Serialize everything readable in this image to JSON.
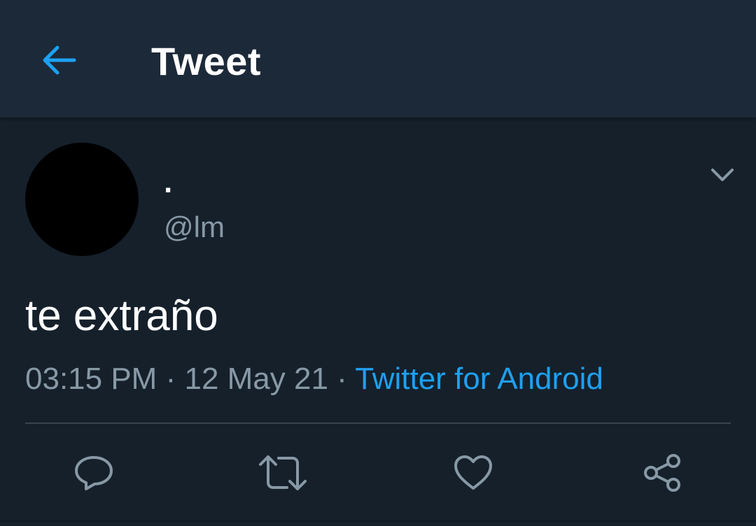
{
  "header": {
    "title": "Tweet",
    "back_icon": "arrow-left-icon"
  },
  "tweet": {
    "display_name": ".",
    "handle": "@lm",
    "text": "te extraño",
    "time": "03:15 PM",
    "date": "12 May 21",
    "separator": "·",
    "source": "Twitter for Android",
    "menu_icon": "chevron-down-icon"
  },
  "actions": [
    "reply-icon",
    "retweet-icon",
    "like-icon",
    "share-icon"
  ],
  "colors": {
    "background": "#15202b",
    "header_background": "#1c2938",
    "accent": "#1da1f2",
    "secondary_text": "#8899a6",
    "avatar": "#000000"
  }
}
